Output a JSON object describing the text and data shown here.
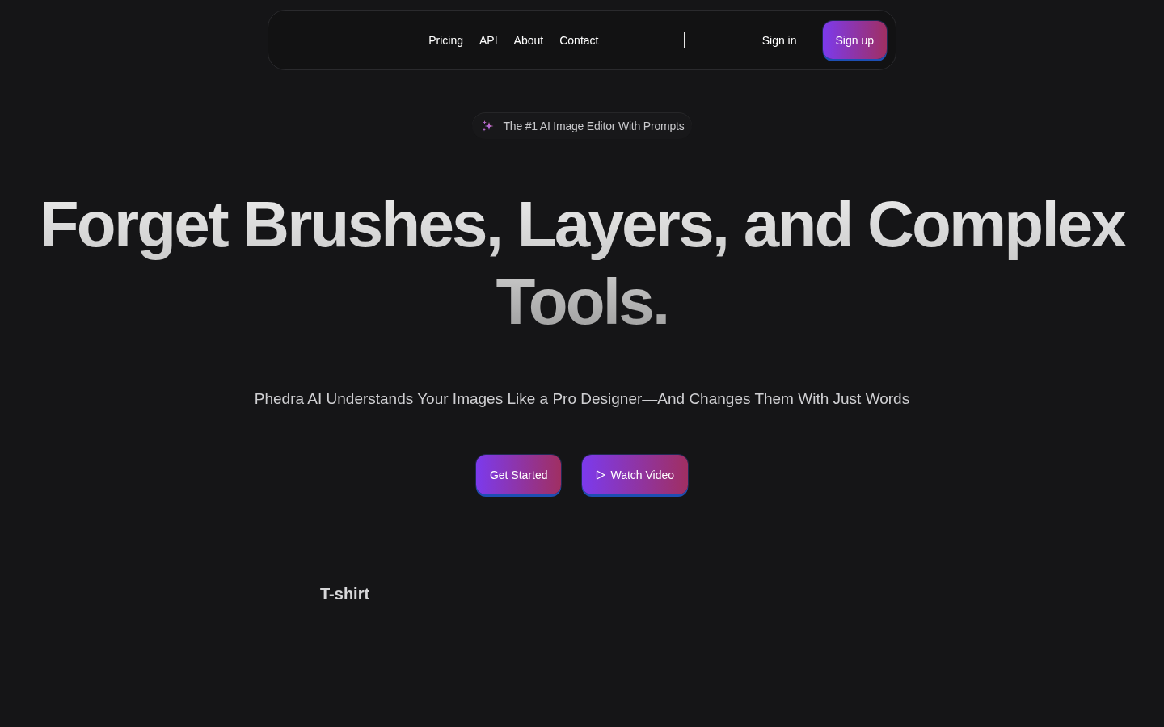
{
  "nav": {
    "links": [
      "Pricing",
      "API",
      "About",
      "Contact"
    ],
    "sign_in": "Sign in",
    "sign_up": "Sign up"
  },
  "badge": {
    "text": "The #1 AI Image Editor With Prompts"
  },
  "hero": {
    "title": "Forget Brushes, Layers, and Complex Tools.",
    "subtitle": "Phedra AI Understands Your Images Like a Pro Designer—And Changes Them With Just Words",
    "buttons": [
      {
        "label": "Get Started",
        "kind": "primary"
      },
      {
        "label": "Watch Video",
        "kind": "video"
      }
    ]
  },
  "carousel": {
    "items": [
      "T-shirt"
    ]
  }
}
